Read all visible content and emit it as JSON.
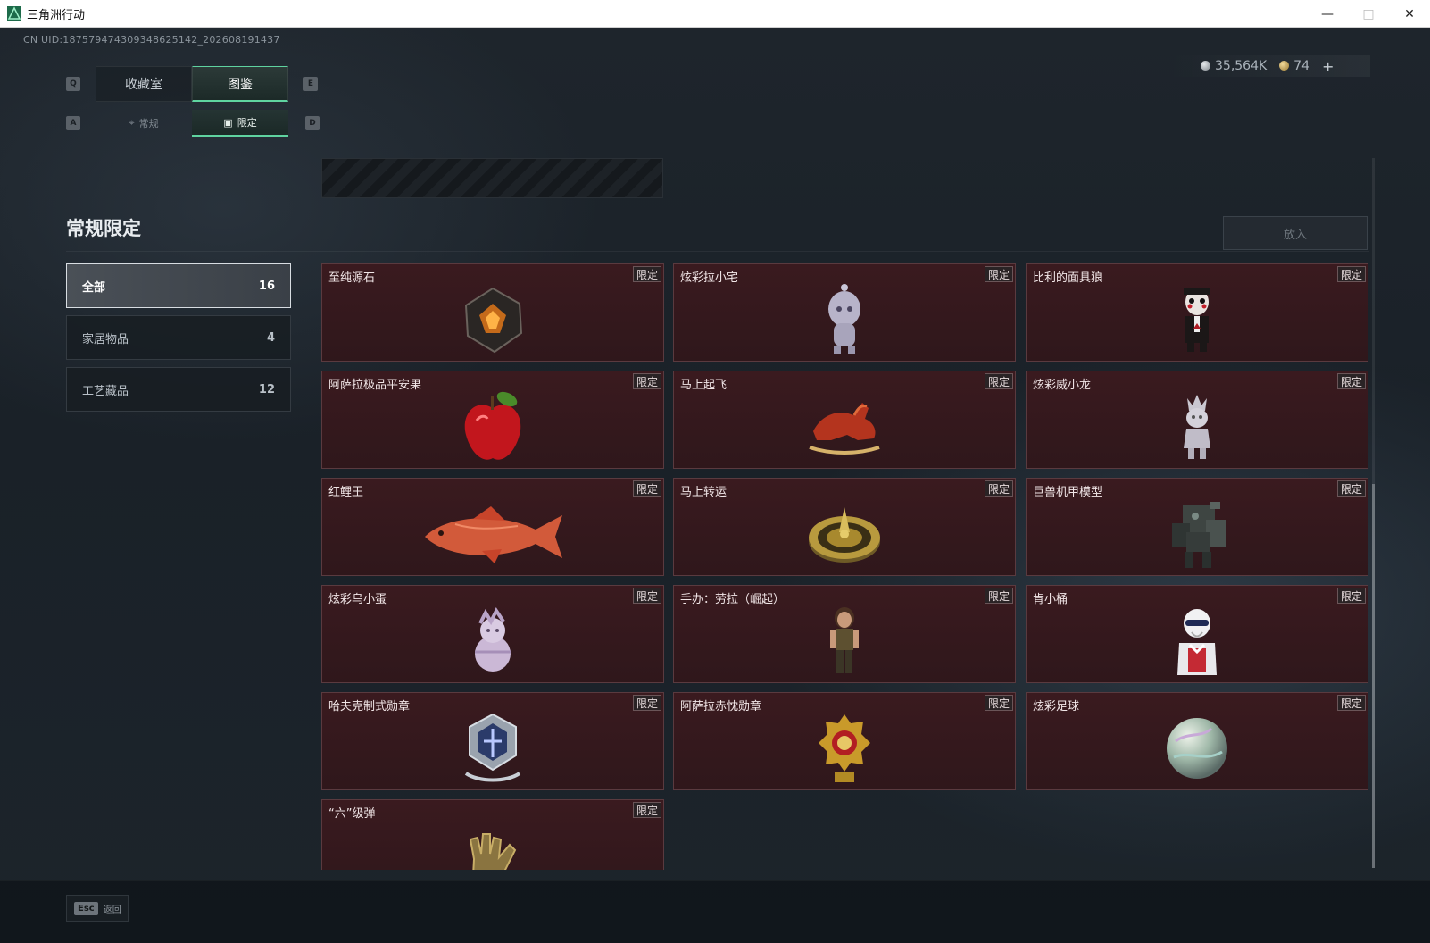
{
  "window": {
    "title": "三角洲行动"
  },
  "header": {
    "uid": "CN UID:1875794743093486251​42_202608191437",
    "currency": {
      "silver": "35,564K",
      "gold": "74",
      "plus": "+"
    }
  },
  "keys": {
    "prev_tab": "Q",
    "next_tab": "E",
    "prev_sub": "A",
    "next_sub": "D"
  },
  "tabs": [
    {
      "label": "收藏室",
      "active": false
    },
    {
      "label": "图鉴",
      "active": true
    }
  ],
  "subtabs": [
    {
      "label": "常规",
      "active": false
    },
    {
      "label": "限定",
      "active": true
    }
  ],
  "section": {
    "title": "常规限定",
    "place_button": "放入"
  },
  "categories": [
    {
      "label": "全部",
      "count": "16",
      "active": true
    },
    {
      "label": "家居物品",
      "count": "4",
      "active": false
    },
    {
      "label": "工艺藏品",
      "count": "12",
      "active": false
    }
  ],
  "items": [
    {
      "name": "至纯源石",
      "tag": "限定",
      "icon": "gem-icon"
    },
    {
      "name": "炫彩拉小宅",
      "tag": "限定",
      "icon": "figurine-icon"
    },
    {
      "name": "比利的面具狼",
      "tag": "限定",
      "icon": "puppet-icon"
    },
    {
      "name": "阿萨拉极品平安果",
      "tag": "限定",
      "icon": "apple-icon"
    },
    {
      "name": "马上起飞",
      "tag": "限定",
      "icon": "horse-icon"
    },
    {
      "name": "炫彩威小龙",
      "tag": "限定",
      "icon": "figurine-icon"
    },
    {
      "name": "红鲤王",
      "tag": "限定",
      "icon": "fish-icon"
    },
    {
      "name": "马上转运",
      "tag": "限定",
      "icon": "compass-icon"
    },
    {
      "name": "巨兽机甲模型",
      "tag": "限定",
      "icon": "mech-icon"
    },
    {
      "name": "炫彩乌小蛋",
      "tag": "限定",
      "icon": "egg-figurine-icon"
    },
    {
      "name": "手办：劳拉（崛起）",
      "tag": "限定",
      "icon": "figure-icon"
    },
    {
      "name": "肯小桶",
      "tag": "限定",
      "icon": "bust-icon"
    },
    {
      "name": "哈夫克制式勋章",
      "tag": "限定",
      "icon": "badge-icon"
    },
    {
      "name": "阿萨拉赤忱勋章",
      "tag": "限定",
      "icon": "medal-icon"
    },
    {
      "name": "炫彩足球",
      "tag": "限定",
      "icon": "ball-icon"
    },
    {
      "name": "“六”级弹",
      "tag": "限定",
      "icon": "hand-icon"
    }
  ],
  "footer": {
    "esc_key": "Esc",
    "back_label": "返回"
  },
  "colors": {
    "accent": "#5fd3a0",
    "card_bg": "#3a1a1f",
    "card_border": "#5a3a3f"
  }
}
